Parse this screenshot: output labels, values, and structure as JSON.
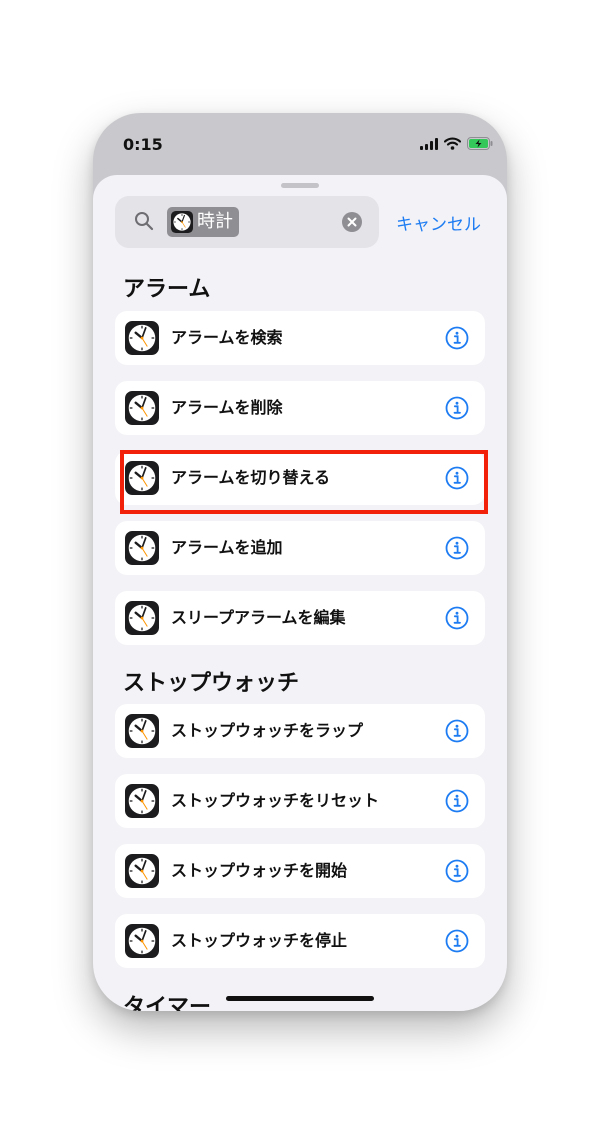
{
  "status_bar": {
    "time": "0:15",
    "icons": [
      "cellular-signal-icon",
      "wifi-icon",
      "battery-charging-icon"
    ],
    "battery_color": "#34c759"
  },
  "search": {
    "icon": "search-icon",
    "token_icon": "clock-app-icon",
    "token_label": "時計",
    "clear_icon": "clear-icon",
    "cancel_label": "キャンセル"
  },
  "sections": {
    "alarm": {
      "title": "アラーム",
      "items": [
        {
          "label": "アラームを検索",
          "icon": "clock-app-icon",
          "info_icon": "info-icon"
        },
        {
          "label": "アラームを削除",
          "icon": "clock-app-icon",
          "info_icon": "info-icon"
        },
        {
          "label": "アラームを切り替える",
          "icon": "clock-app-icon",
          "info_icon": "info-icon",
          "highlighted": true
        },
        {
          "label": "アラームを追加",
          "icon": "clock-app-icon",
          "info_icon": "info-icon"
        },
        {
          "label": "スリープアラームを編集",
          "icon": "clock-app-icon",
          "info_icon": "info-icon"
        }
      ]
    },
    "stopwatch": {
      "title": "ストップウォッチ",
      "items": [
        {
          "label": "ストップウォッチをラップ",
          "icon": "clock-app-icon",
          "info_icon": "info-icon"
        },
        {
          "label": "ストップウォッチをリセット",
          "icon": "clock-app-icon",
          "info_icon": "info-icon"
        },
        {
          "label": "ストップウォッチを開始",
          "icon": "clock-app-icon",
          "info_icon": "info-icon"
        },
        {
          "label": "ストップウォッチを停止",
          "icon": "clock-app-icon",
          "info_icon": "info-icon"
        }
      ]
    },
    "timer": {
      "title": "タイマー"
    }
  },
  "colors": {
    "accent": "#1e7cf2",
    "highlight": "#f2210a",
    "sheet_background": "#f2f2f7"
  }
}
